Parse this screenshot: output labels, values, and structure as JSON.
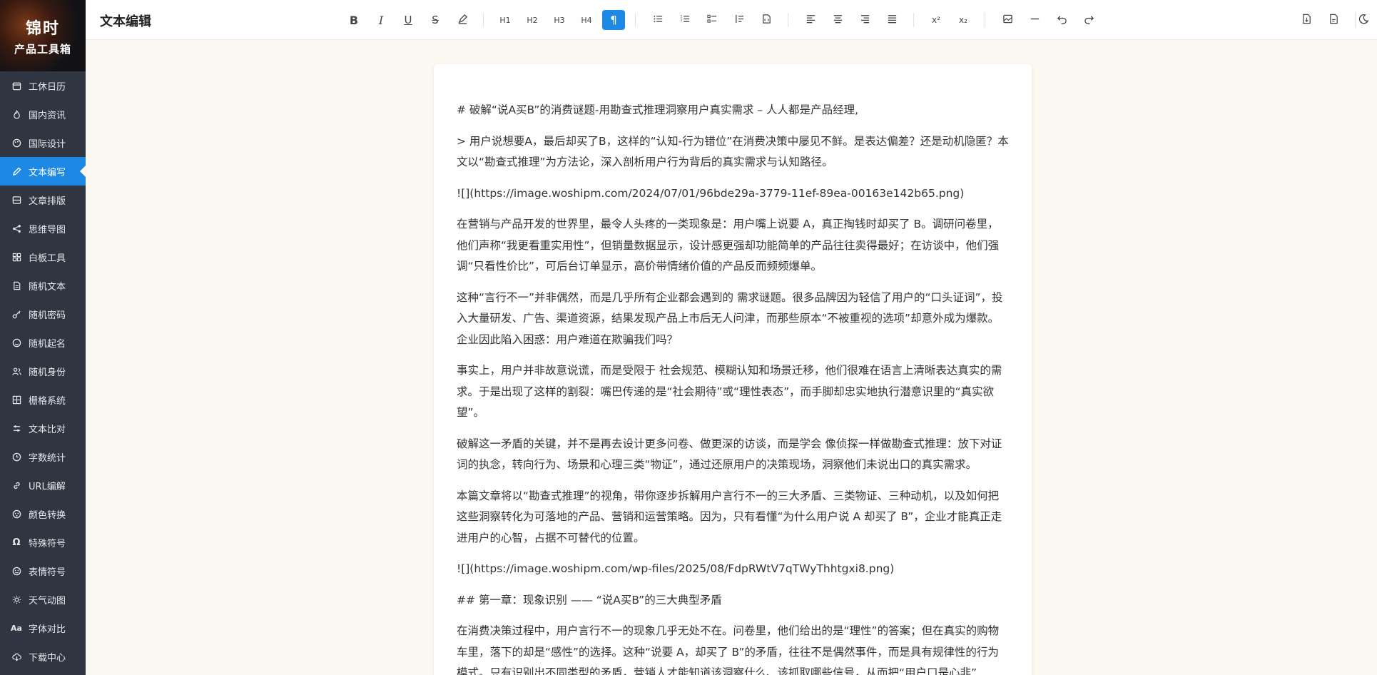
{
  "brand": {
    "line1": "锦时",
    "line2": "产品工具箱"
  },
  "sidebar": {
    "items": [
      {
        "label": "工休日历",
        "icon": "calendar-icon"
      },
      {
        "label": "国内资讯",
        "icon": "flame-icon"
      },
      {
        "label": "国际设计",
        "icon": "palette-icon"
      },
      {
        "label": "文本编写",
        "icon": "pen-icon",
        "active": true
      },
      {
        "label": "文章排版",
        "icon": "layout-icon"
      },
      {
        "label": "思维导图",
        "icon": "share-icon"
      },
      {
        "label": "白板工具",
        "icon": "board-icon"
      },
      {
        "label": "随机文本",
        "icon": "document-icon"
      },
      {
        "label": "随机密码",
        "icon": "key-icon"
      },
      {
        "label": "随机起名",
        "icon": "smile-icon"
      },
      {
        "label": "随机身份",
        "icon": "users-icon"
      },
      {
        "label": "栅格系统",
        "icon": "grid-icon"
      },
      {
        "label": "文本比对",
        "icon": "compare-icon"
      },
      {
        "label": "字数统计",
        "icon": "clock-icon"
      },
      {
        "label": "URL编解",
        "icon": "link-icon"
      },
      {
        "label": "颜色转换",
        "icon": "color-icon"
      },
      {
        "label": "特殊符号",
        "icon": "omega-icon"
      },
      {
        "label": "表情符号",
        "icon": "emoji-icon"
      },
      {
        "label": "天气动图",
        "icon": "sun-icon"
      },
      {
        "label": "字体对比",
        "icon": "font-icon"
      },
      {
        "label": "下载中心",
        "icon": "cloud-download-icon"
      }
    ]
  },
  "header": {
    "title": "文本编辑"
  },
  "toolbar": {
    "h1": "H1",
    "h2": "H2",
    "h3": "H3",
    "h4": "H4",
    "superscript": "x²",
    "subscript": "x₂",
    "active_tool": "paragraph"
  },
  "colors": {
    "sidebar_bg": "#2f3541",
    "accent": "#1e88e5",
    "page_bg": "#fbf9f1"
  },
  "document": {
    "paragraphs": [
      "# 破解“说A买B”的消费谜题-用勘查式推理洞察用户真实需求 – 人人都是产品经理,",
      "> 用户说想要A，最后却买了B，这样的“认知-行为错位”在消费决策中屡见不鲜。是表达偏差？还是动机隐匿？本文以“勘查式推理”为方法论，深入剖析用户行为背后的真实需求与认知路径。",
      "![](https://image.woshipm.com/2024/07/01/96bde29a-3779-11ef-89ea-00163e142b65.png)",
      "在营销与产品开发的世界里，最令人头疼的一类现象是：用户嘴上说要 A，真正掏钱时却买了 B。调研问卷里，他们声称“我更看重实用性”，但销量数据显示，设计感更强却功能简单的产品往往卖得最好；在访谈中，他们强调“只看性价比”，可后台订单显示，高价带情绪价值的产品反而频频爆单。",
      "这种“言行不一”并非偶然，而是几乎所有企业都会遇到的 需求谜题。很多品牌因为轻信了用户的“口头证词”，投入大量研发、广告、渠道资源，结果发现产品上市后无人问津，而那些原本“不被重视的选项”却意外成为爆款。企业因此陷入困惑：用户难道在欺骗我们吗？",
      "事实上，用户并非故意说谎，而是受限于 社会规范、模糊认知和场景迁移，他们很难在语言上清晰表达真实的需求。于是出现了这样的割裂：嘴巴传递的是“社会期待”或“理性表态”，而手脚却忠实地执行潜意识里的“真实欲望”。",
      "破解这一矛盾的关键，并不是再去设计更多问卷、做更深的访谈，而是学会 像侦探一样做勘查式推理：放下对证词的执念，转向行为、场景和心理三类“物证”，通过还原用户的决策现场，洞察他们未说出口的真实需求。",
      "本篇文章将以“勘查式推理”的视角，带你逐步拆解用户言行不一的三大矛盾、三类物证、三种动机，以及如何把这些洞察转化为可落地的产品、营销和运营策略。因为，只有看懂“为什么用户说 A 却买了 B”，企业才能真正走进用户的心智，占据不可替代的位置。",
      "![](https://image.woshipm.com/wp-files/2025/08/FdpRWtV7qTWyThhtgxi8.png)",
      "## 第一章：现象识别 —— “说A买B”的三大典型矛盾",
      "在消费决策过程中，用户言行不一的现象几乎无处不在。问卷里，他们给出的是“理性”的答案；但在真实的购物车里，落下的却是“感性”的选择。这种“说要 A，却买了 B”的矛盾，往往不是偶然事件，而是具有规律性的行为模式。只有识别出不同类型的矛盾，营销人才能知道该洞察什么、该抓取哪些信号，从而把“用户口是心非”"
    ]
  }
}
